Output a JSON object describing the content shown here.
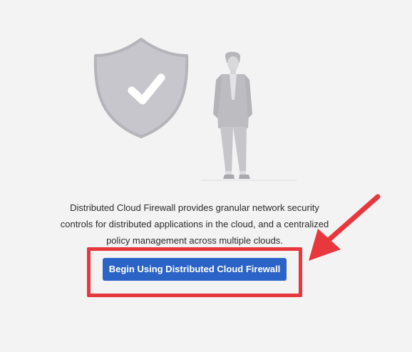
{
  "description": {
    "line1": "Distributed Cloud Firewall provides granular network security",
    "line2": "controls for distributed applications in the cloud, and a centralized",
    "line3": "policy management across multiple clouds."
  },
  "cta": {
    "label": "Begin Using Distributed Cloud Firewall"
  },
  "icons": {
    "shield": "shield-check-icon",
    "person": "person-illustration"
  },
  "colors": {
    "background": "#f3f3f4",
    "button": "#2b64c6",
    "annotation": "#e8373d",
    "shield": "#c6c6cc"
  }
}
